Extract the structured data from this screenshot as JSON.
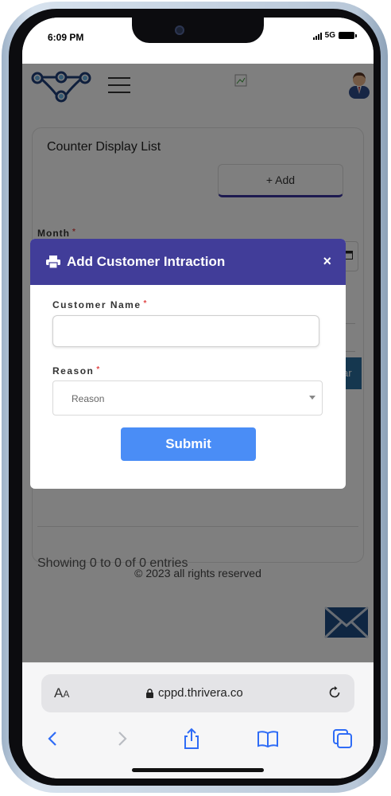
{
  "status_bar": {
    "time": "6:09 PM",
    "network": "5G"
  },
  "page": {
    "card_title": "Counter Display List",
    "add_button": "+ Add",
    "month_label": "Month",
    "required_mark": "*",
    "partial_button": "ar",
    "entries_info": "Showing 0 to 0 of 0 entries",
    "footer": "© 2023 all rights reserved"
  },
  "modal": {
    "title": "Add Customer Intraction",
    "close_label": "×",
    "customer_name_label": "Customer Name",
    "customer_name_value": "",
    "reason_label": "Reason",
    "reason_selected": "Reason",
    "submit_label": "Submit"
  },
  "browser": {
    "aa_label_big": "A",
    "aa_label_small": "A",
    "url": "cppd.thrivera.co"
  },
  "colors": {
    "modal_header": "#413d99",
    "submit_button": "#4a8df6",
    "required": "#e04848",
    "safari_tint": "#2f6cf6"
  },
  "icons": [
    "printer-icon",
    "close-icon",
    "calendar-icon",
    "mail-icon",
    "lock-icon",
    "reload-icon",
    "back-icon",
    "forward-icon",
    "share-icon",
    "bookmarks-icon",
    "tabs-icon"
  ]
}
